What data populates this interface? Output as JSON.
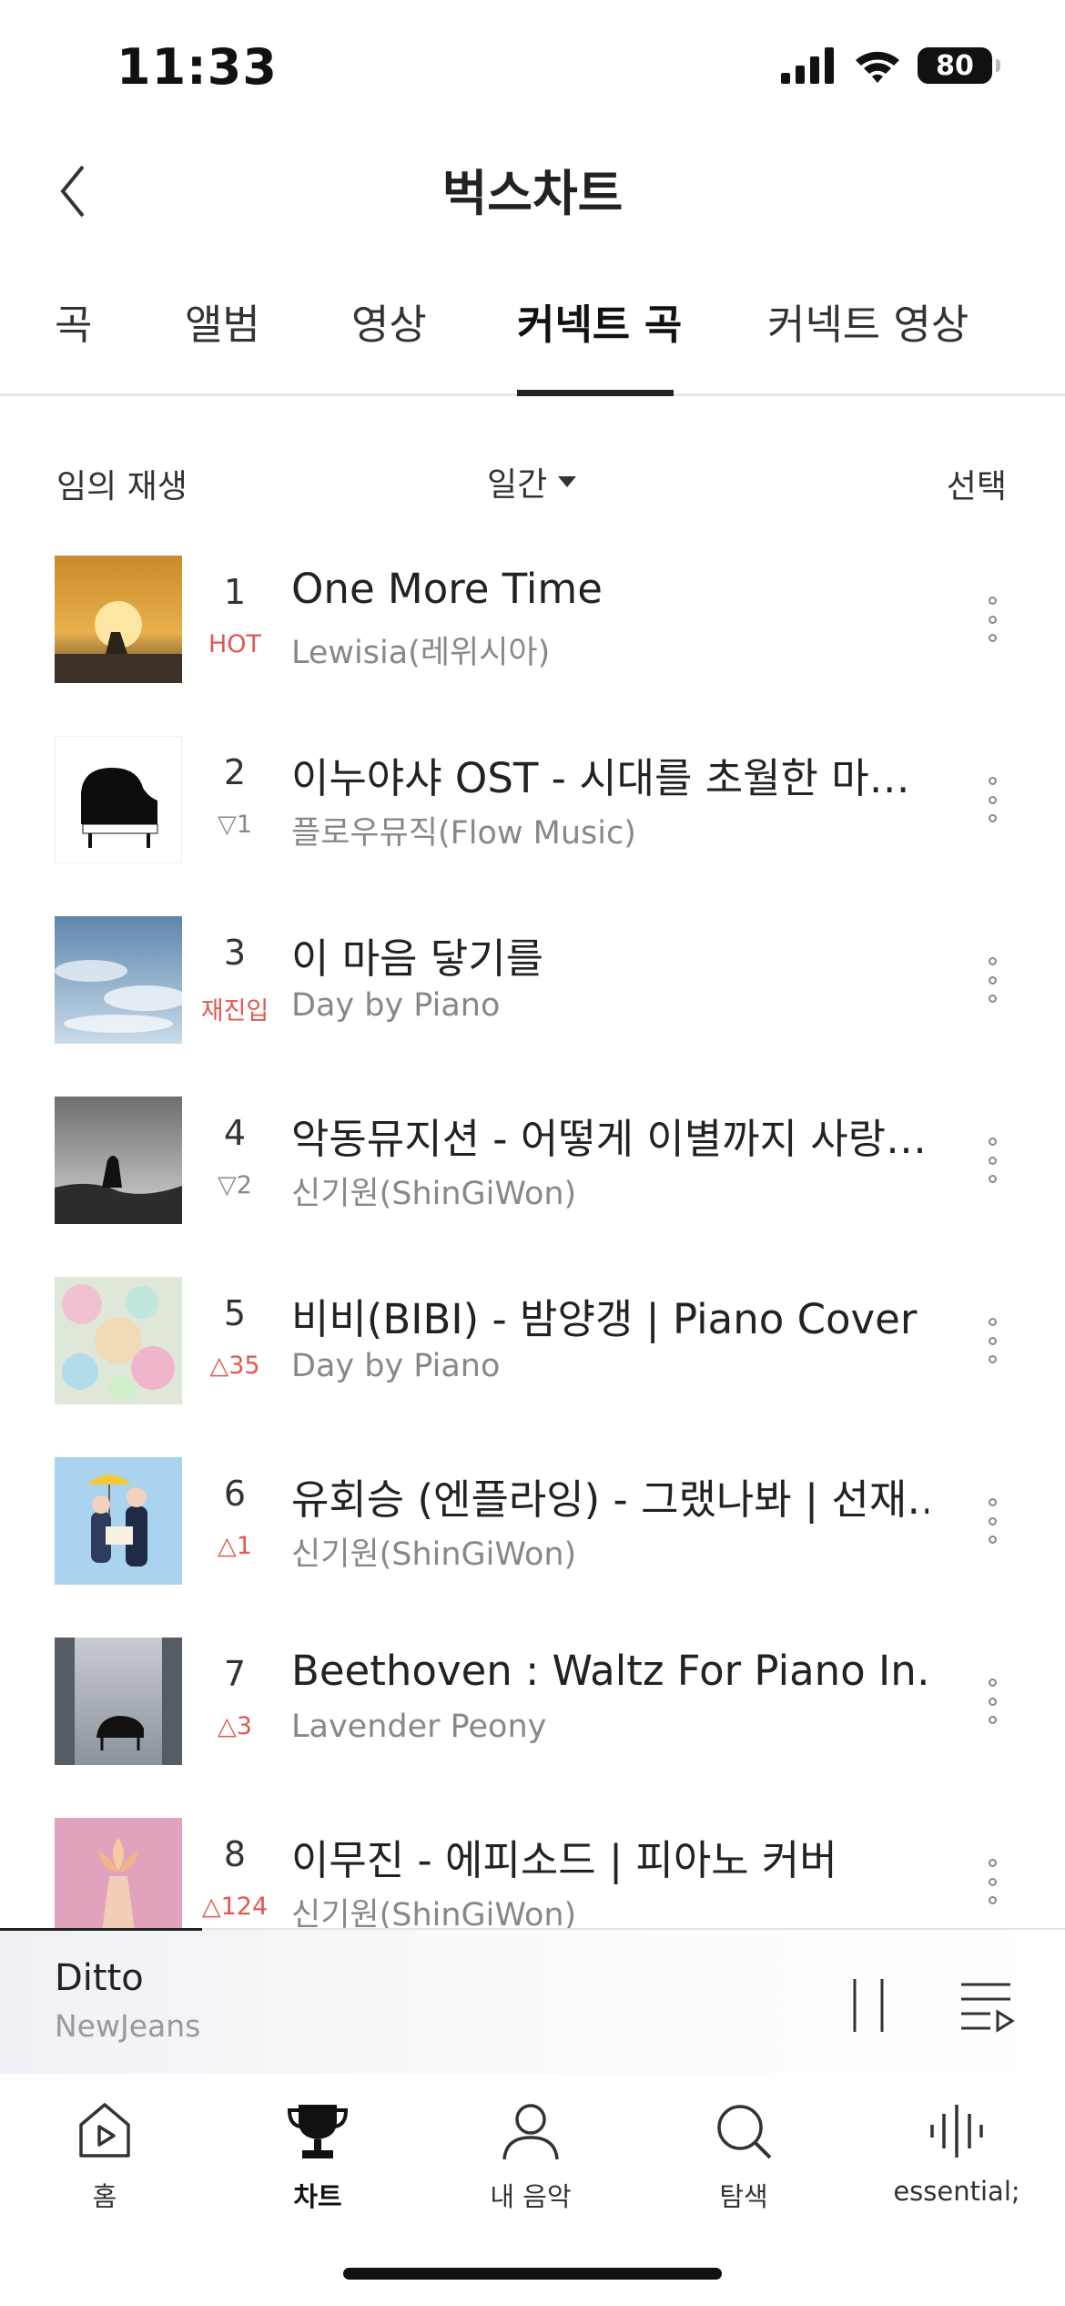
{
  "status_bar": {
    "time": "11:33",
    "battery": "80"
  },
  "header": {
    "title": "벅스차트"
  },
  "tabs": [
    {
      "label": "곡",
      "active": false
    },
    {
      "label": "앨범",
      "active": false
    },
    {
      "label": "영상",
      "active": false
    },
    {
      "label": "커넥트 곡",
      "active": true
    },
    {
      "label": "커넥트 영상",
      "active": false
    }
  ],
  "toolbar": {
    "shuffle_label": "임의 재생",
    "period": "일간",
    "select_label": "선택"
  },
  "tracks": [
    {
      "rank": "1",
      "change": "HOT",
      "change_type": "hot",
      "title": "One More Time",
      "artist": "Lewisia(레위시아)"
    },
    {
      "rank": "2",
      "change": "▽1",
      "change_type": "down",
      "title": "이누야샤 OST - 시대를 초월한 마…",
      "artist": "플로우뮤직(Flow Music)"
    },
    {
      "rank": "3",
      "change": "재진입",
      "change_type": "reenter",
      "title": "이 마음 닿기를",
      "artist": "Day by Piano"
    },
    {
      "rank": "4",
      "change": "▽2",
      "change_type": "down",
      "title": "악동뮤지션 - 어떻게 이별까지 사랑…",
      "artist": "신기원(ShinGiWon)"
    },
    {
      "rank": "5",
      "change": "△35",
      "change_type": "up",
      "title": "비비(BIBI) - 밤양갱 | Piano Cover",
      "artist": "Day by Piano"
    },
    {
      "rank": "6",
      "change": "△1",
      "change_type": "up",
      "title": "유회승 (엔플라잉) - 그랬나봐 | 선재…",
      "artist": "신기원(ShinGiWon)"
    },
    {
      "rank": "7",
      "change": "△3",
      "change_type": "up",
      "title": "Beethoven : Waltz For Piano In…",
      "artist": "Lavender Peony"
    },
    {
      "rank": "8",
      "change": "△124",
      "change_type": "up",
      "title": "이무진 - 에피소드 | 피아노 커버",
      "artist": "신기원(ShinGiWon)"
    }
  ],
  "now_playing": {
    "title": "Ditto",
    "artist": "NewJeans",
    "progress": 0.19
  },
  "nav": [
    {
      "label": "홈",
      "icon": "home-play-icon",
      "active": false
    },
    {
      "label": "차트",
      "icon": "trophy-icon",
      "active": true
    },
    {
      "label": "내 음악",
      "icon": "person-icon",
      "active": false
    },
    {
      "label": "탐색",
      "icon": "search-icon",
      "active": false
    },
    {
      "label": "essential;",
      "icon": "soundwave-icon",
      "active": false
    }
  ],
  "colors": {
    "accent_red": "#e0584e",
    "text_primary": "#222222",
    "text_secondary": "#888888"
  }
}
